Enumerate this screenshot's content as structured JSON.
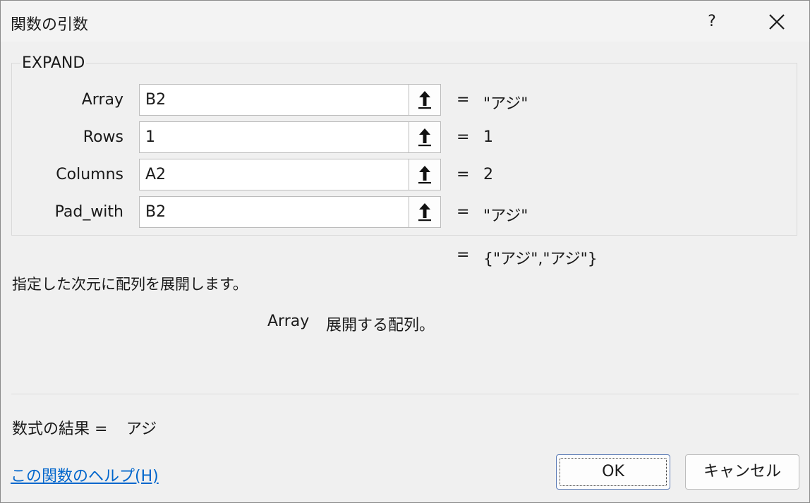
{
  "dialog": {
    "title": "関数の引数",
    "help_symbol": "?",
    "function_name": "EXPAND"
  },
  "args": [
    {
      "label": "Array",
      "value": "B2",
      "result": "\"アジ\""
    },
    {
      "label": "Rows",
      "value": "1",
      "result": "1"
    },
    {
      "label": "Columns",
      "value": "A2",
      "result": "2"
    },
    {
      "label": "Pad_with",
      "value": "B2",
      "result": "\"アジ\""
    }
  ],
  "equals": "=",
  "function_result": "{\"アジ\",\"アジ\"}",
  "description": "指定した次元に配列を展開します。",
  "arg_description": {
    "name": "Array",
    "text": "展開する配列。"
  },
  "formula_result": {
    "label": "数式の結果 =",
    "value": "アジ"
  },
  "footer": {
    "help_link": "この関数のヘルプ(H)",
    "ok_label": "OK",
    "cancel_label": "キャンセル"
  },
  "icons": {
    "collapse": "collapse-dialog-arrow-icon",
    "close": "close-icon"
  }
}
